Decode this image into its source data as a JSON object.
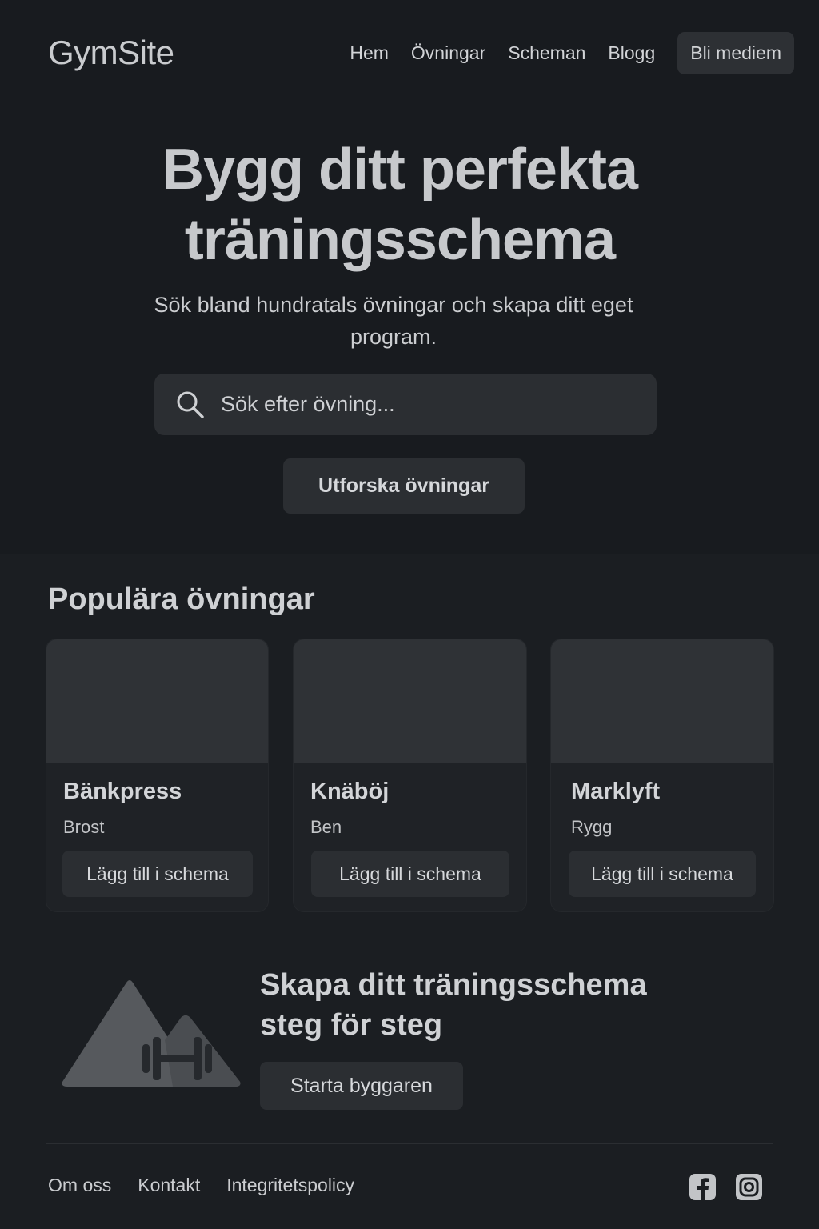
{
  "header": {
    "logo": "GymSite",
    "nav": [
      {
        "label": "Hem"
      },
      {
        "label": "Övningar"
      },
      {
        "label": "Scheman"
      },
      {
        "label": "Blogg"
      }
    ],
    "cta_label": "Bli mediem"
  },
  "hero": {
    "title_line1": "Bygg ditt perfekta",
    "title_line2": "träningsschema",
    "subtitle": "Sök bland hundratals övningar och skapa ditt eget program.",
    "search": {
      "placeholder": "Sök efter övning...",
      "icon": "search-icon"
    },
    "explore_label": "Utforska övningar"
  },
  "popular": {
    "title": "Populära övningar",
    "cards": [
      {
        "title": "Bänkpress",
        "category": "Brost",
        "button": "Lägg till i schema"
      },
      {
        "title": "Knäböj",
        "category": "Ben",
        "button": "Lägg till i schema"
      },
      {
        "title": "Marklyft",
        "category": "Rygg",
        "button": "Lägg till i schema"
      }
    ]
  },
  "builder": {
    "title_line1": "Skapa ditt träningsschema",
    "title_line2": "steg för steg",
    "button": "Starta byggaren",
    "illustration": "mountain-dumbbell-icon"
  },
  "footer": {
    "links": [
      {
        "label": "Om oss"
      },
      {
        "label": "Kontakt"
      },
      {
        "label": "Integritetspolicy"
      }
    ],
    "social": [
      "facebook-icon",
      "instagram-icon"
    ]
  },
  "colors": {
    "hero_bg": "#181b1f",
    "page_bg": "#1b1e22",
    "surface": "#2b2e32",
    "text": "#d6d8db"
  }
}
